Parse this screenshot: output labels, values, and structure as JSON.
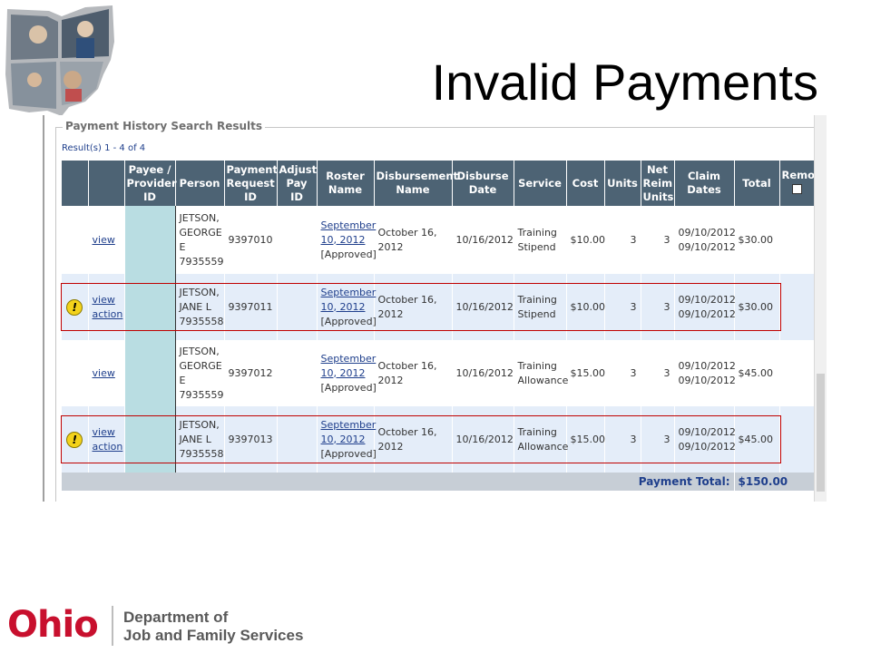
{
  "slide": {
    "title": "Invalid Payments",
    "footer": {
      "ohio": "Ohio",
      "dept_line1": "Department of",
      "dept_line2": "Job and Family Services"
    }
  },
  "panel": {
    "legend": "Payment History Search Results",
    "result_count": "Result(s) 1 - 4 of 4",
    "columns": {
      "action": "",
      "payee": "Payee / Provider ID",
      "person": "Person",
      "request": "Payment Request ID",
      "adjust": "Adjust Pay ID",
      "roster": "Roster Name",
      "disb_name": "Disbursement Name",
      "disb_date": "Disburse Date",
      "service": "Service",
      "cost": "Cost",
      "units": "Units",
      "net": "Net Reim Units",
      "claim": "Claim Dates",
      "total": "Total",
      "remove": "Remo"
    },
    "rows": [
      {
        "warning": false,
        "view": "view",
        "action": "",
        "person": "JETSON, GEORGE E 7935559",
        "request": "9397010",
        "adjust": "",
        "roster": "September 10, 2012",
        "roster_status": "[Approved]",
        "disb_name": "October 16, 2012",
        "disb_date": "10/16/2012",
        "service": "Training Stipend",
        "cost": "$10.00",
        "units": "3",
        "net": "3",
        "claim": "09/10/2012 09/10/2012",
        "total": "$30.00"
      },
      {
        "warning": true,
        "view": "view",
        "action": "action",
        "person": "JETSON, JANE L 7935558",
        "request": "9397011",
        "adjust": "",
        "roster": "September 10, 2012",
        "roster_status": "[Approved]",
        "disb_name": "October 16, 2012",
        "disb_date": "10/16/2012",
        "service": "Training Stipend",
        "cost": "$10.00",
        "units": "3",
        "net": "3",
        "claim": "09/10/2012 09/10/2012",
        "total": "$30.00"
      },
      {
        "warning": false,
        "view": "view",
        "action": "",
        "person": "JETSON, GEORGE E 7935559",
        "request": "9397012",
        "adjust": "",
        "roster": "September 10, 2012",
        "roster_status": "[Approved]",
        "disb_name": "October 16, 2012",
        "disb_date": "10/16/2012",
        "service": "Training Allowance",
        "cost": "$15.00",
        "units": "3",
        "net": "3",
        "claim": "09/10/2012 09/10/2012",
        "total": "$45.00"
      },
      {
        "warning": true,
        "view": "view",
        "action": "action",
        "person": "JETSON, JANE L 7935558",
        "request": "9397013",
        "adjust": "",
        "roster": "September 10, 2012",
        "roster_status": "[Approved]",
        "disb_name": "October 16, 2012",
        "disb_date": "10/16/2012",
        "service": "Training Allowance",
        "cost": "$15.00",
        "units": "3",
        "net": "3",
        "claim": "09/10/2012 09/10/2012",
        "total": "$45.00"
      }
    ],
    "payment_total_label": "Payment Total:",
    "payment_total_value": "$150.00",
    "warning_icon_glyph": "!"
  },
  "colors": {
    "header_bg": "#4d6374",
    "alt_row_bg": "#e4edf9",
    "payee_highlight": "#b9dde2",
    "highlight_border": "#c00000",
    "ohio_red": "#c8102e",
    "link": "#1f3f8c"
  }
}
